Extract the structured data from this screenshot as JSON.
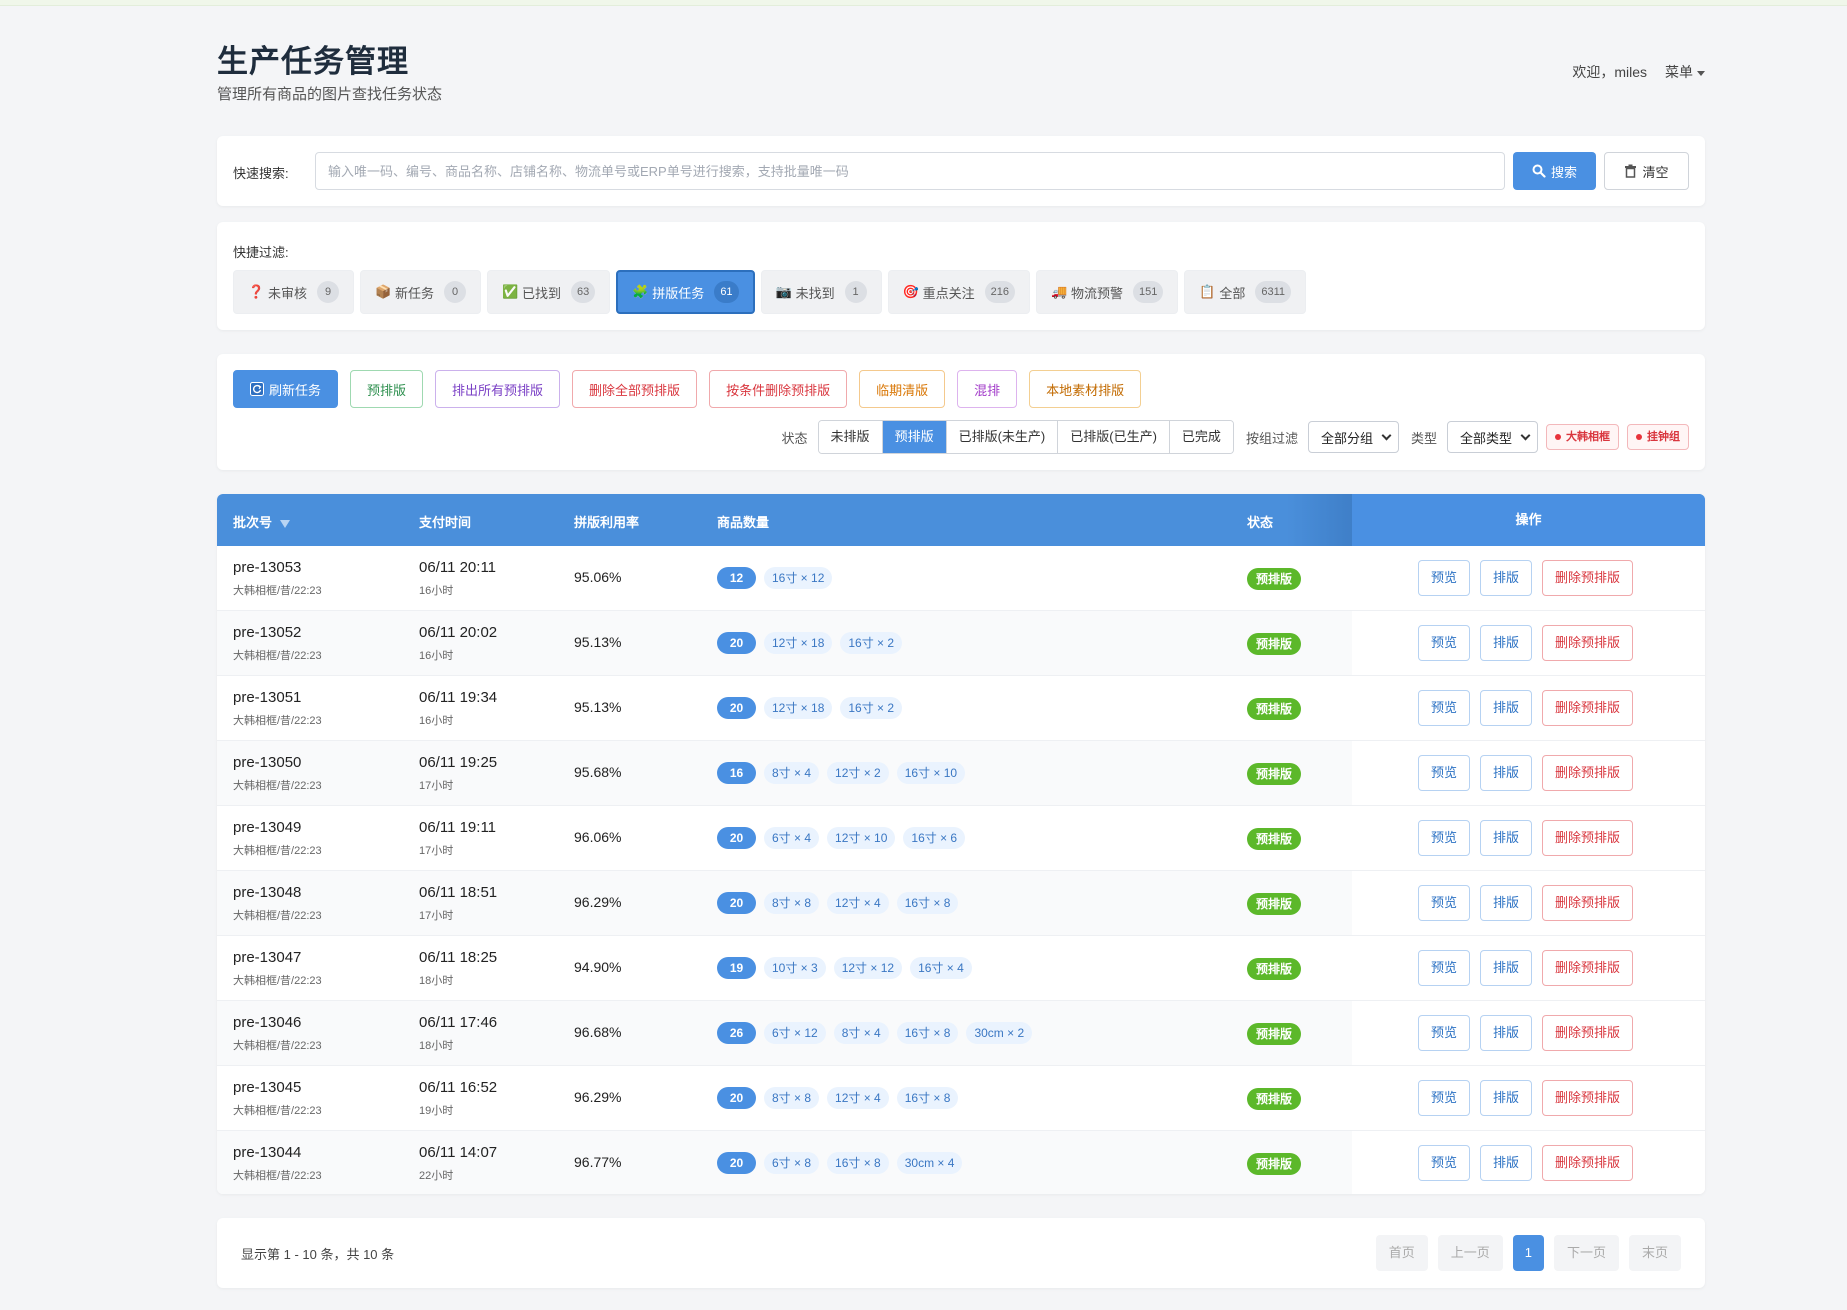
{
  "header": {
    "title": "生产任务管理",
    "subtitle": "管理所有商品的图片查找任务状态",
    "welcome": "欢迎，miles",
    "menu_label": "菜单"
  },
  "search": {
    "label": "快速搜索:",
    "placeholder": "输入唯一码、编号、商品名称、店铺名称、物流单号或ERP单号进行搜索，支持批量唯一码",
    "value": "",
    "search_label": "搜索",
    "clear_label": "清空"
  },
  "filters": {
    "label": "快捷过滤:",
    "items": [
      {
        "icon": "❓",
        "label": "未审核",
        "count": "9"
      },
      {
        "icon": "📦",
        "label": "新任务",
        "count": "0"
      },
      {
        "icon": "✅",
        "label": "已找到",
        "count": "63"
      },
      {
        "icon": "🧩",
        "label": "拼版任务",
        "count": "61"
      },
      {
        "icon": "📷",
        "label": "未找到",
        "count": "1"
      },
      {
        "icon": "🎯",
        "label": "重点关注",
        "count": "216"
      },
      {
        "icon": "🚚",
        "label": "物流预警",
        "count": "151"
      },
      {
        "icon": "📋",
        "label": "全部",
        "count": "6311"
      }
    ]
  },
  "actions": {
    "refresh": "刷新任务",
    "pre_layout": "预排版",
    "export_all_pre": "排出所有预排版",
    "delete_all_pre": "删除全部预排版",
    "delete_by_condition": "按条件删除预排版",
    "expiring": "临期清版",
    "mixed": "混排",
    "local_material": "本地素材排版"
  },
  "status_filter": {
    "label": "状态",
    "options": [
      "未排版",
      "预排版",
      "已排版(未生产)",
      "已排版(已生产)",
      "已完成"
    ],
    "group_label": "按组过滤",
    "group_value": "全部分组",
    "type_label": "类型",
    "type_value": "全部类型",
    "tag1": "大韩相框",
    "tag2": "挂钟组"
  },
  "table": {
    "headers": {
      "batch": "批次号",
      "pay_time": "支付时间",
      "rate": "拼版利用率",
      "qty": "商品数量",
      "status": "状态",
      "ops": "操作"
    },
    "op_labels": {
      "preview": "预览",
      "layout": "排版",
      "delete": "删除预排版"
    },
    "rows": [
      {
        "batch": "pre-13053",
        "sub": "大韩相框/昔/22:23",
        "time": "06/11 20:11",
        "ago": "16小时",
        "rate": "95.06%",
        "total": "12",
        "chips": [
          "16寸 × 12"
        ],
        "status": "预排版"
      },
      {
        "batch": "pre-13052",
        "sub": "大韩相框/昔/22:23",
        "time": "06/11 20:02",
        "ago": "16小时",
        "rate": "95.13%",
        "total": "20",
        "chips": [
          "12寸 × 18",
          "16寸 × 2"
        ],
        "status": "预排版"
      },
      {
        "batch": "pre-13051",
        "sub": "大韩相框/昔/22:23",
        "time": "06/11 19:34",
        "ago": "16小时",
        "rate": "95.13%",
        "total": "20",
        "chips": [
          "12寸 × 18",
          "16寸 × 2"
        ],
        "status": "预排版"
      },
      {
        "batch": "pre-13050",
        "sub": "大韩相框/昔/22:23",
        "time": "06/11 19:25",
        "ago": "17小时",
        "rate": "95.68%",
        "total": "16",
        "chips": [
          "8寸 × 4",
          "12寸 × 2",
          "16寸 × 10"
        ],
        "status": "预排版"
      },
      {
        "batch": "pre-13049",
        "sub": "大韩相框/昔/22:23",
        "time": "06/11 19:11",
        "ago": "17小时",
        "rate": "96.06%",
        "total": "20",
        "chips": [
          "6寸 × 4",
          "12寸 × 10",
          "16寸 × 6"
        ],
        "status": "预排版"
      },
      {
        "batch": "pre-13048",
        "sub": "大韩相框/昔/22:23",
        "time": "06/11 18:51",
        "ago": "17小时",
        "rate": "96.29%",
        "total": "20",
        "chips": [
          "8寸 × 8",
          "12寸 × 4",
          "16寸 × 8"
        ],
        "status": "预排版"
      },
      {
        "batch": "pre-13047",
        "sub": "大韩相框/昔/22:23",
        "time": "06/11 18:25",
        "ago": "18小时",
        "rate": "94.90%",
        "total": "19",
        "chips": [
          "10寸 × 3",
          "12寸 × 12",
          "16寸 × 4"
        ],
        "status": "预排版"
      },
      {
        "batch": "pre-13046",
        "sub": "大韩相框/昔/22:23",
        "time": "06/11 17:46",
        "ago": "18小时",
        "rate": "96.68%",
        "total": "26",
        "chips": [
          "6寸 × 12",
          "8寸 × 4",
          "16寸 × 8",
          "30cm × 2"
        ],
        "status": "预排版"
      },
      {
        "batch": "pre-13045",
        "sub": "大韩相框/昔/22:23",
        "time": "06/11 16:52",
        "ago": "19小时",
        "rate": "96.29%",
        "total": "20",
        "chips": [
          "8寸 × 8",
          "12寸 × 4",
          "16寸 × 8"
        ],
        "status": "预排版"
      },
      {
        "batch": "pre-13044",
        "sub": "大韩相框/昔/22:23",
        "time": "06/11 14:07",
        "ago": "22小时",
        "rate": "96.77%",
        "total": "20",
        "chips": [
          "6寸 × 8",
          "16寸 × 8",
          "30cm × 4"
        ],
        "status": "预排版"
      }
    ]
  },
  "pagination": {
    "info": "显示第 1 - 10 条，共 10 条",
    "first": "首页",
    "prev": "上一页",
    "current": "1",
    "next": "下一页",
    "last": "末页"
  }
}
